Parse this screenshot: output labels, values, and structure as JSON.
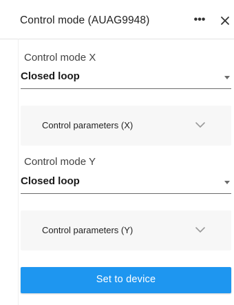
{
  "header": {
    "title": "Control mode (AUAG9948)",
    "more_label": "•••",
    "icons": {
      "more": "more-horizontal-icon",
      "close": "close-icon"
    }
  },
  "mode_x": {
    "label": "Control mode X",
    "value": "Closed loop"
  },
  "params_x": {
    "label": "Control parameters (X)",
    "expanded": false,
    "icon": "chevron-down-icon"
  },
  "mode_y": {
    "label": "Control mode Y",
    "value": "Closed loop"
  },
  "params_y": {
    "label": "Control parameters (Y)",
    "expanded": false,
    "icon": "chevron-down-icon"
  },
  "actions": {
    "set_label": "Set to device"
  },
  "colors": {
    "accent": "#1e96f0",
    "accordion_bg": "#f7f7f7",
    "text": "#212121"
  }
}
